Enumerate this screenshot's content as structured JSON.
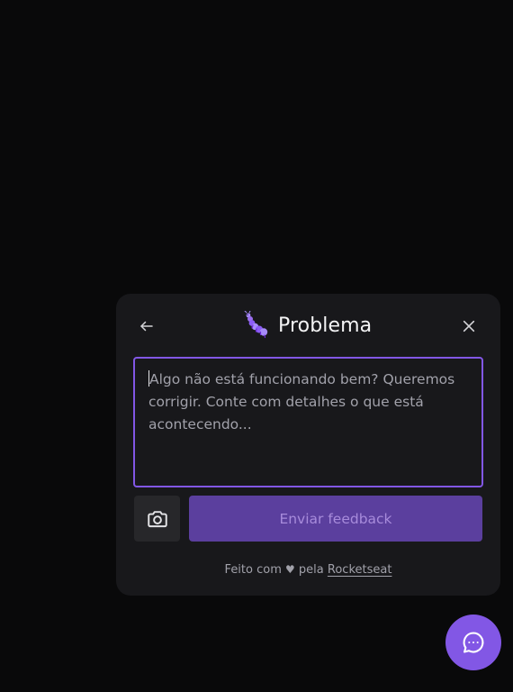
{
  "colors": {
    "page_background": "#09090a",
    "panel_background": "#18181b",
    "accent": "#8257e5",
    "button_disabled": "#5b3f9e",
    "secondary_button": "#27272a",
    "text_primary": "#f4f4f5",
    "text_secondary": "#a1a1aa"
  },
  "widget": {
    "header": {
      "back_icon": "arrow-left-icon",
      "type_icon": "bug-icon",
      "title": "Problema",
      "close_icon": "close-icon"
    },
    "comment": {
      "value": "",
      "placeholder": "Algo não está funcionando bem? Queremos corrigir. Conte com detalhes o que está acontecendo..."
    },
    "screenshot_button": {
      "icon": "camera-icon"
    },
    "submit_button": {
      "label": "Enviar feedback",
      "state": "disabled"
    },
    "footer": {
      "prefix": "Feito com",
      "heart": "♥",
      "middle": "pela",
      "link": "Rocketseat"
    }
  },
  "launcher": {
    "icon": "chat-bubble-icon"
  }
}
